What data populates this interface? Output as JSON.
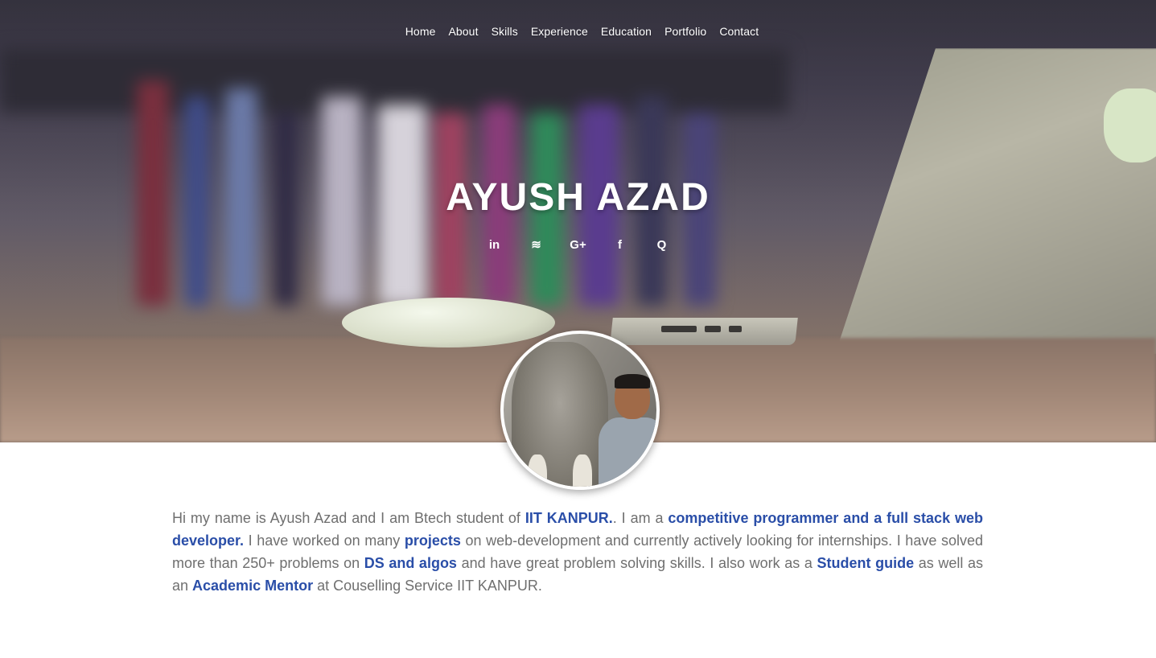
{
  "nav": {
    "items": [
      "Home",
      "About",
      "Skills",
      "Experience",
      "Education",
      "Portfolio",
      "Contact"
    ]
  },
  "hero": {
    "name": "AYUSH AZAD",
    "social": [
      {
        "icon": "linkedin-icon",
        "glyph": "in"
      },
      {
        "icon": "stack-overflow-icon",
        "glyph": "≋"
      },
      {
        "icon": "google-plus-icon",
        "glyph": "G+"
      },
      {
        "icon": "facebook-icon",
        "glyph": "f"
      },
      {
        "icon": "quora-icon",
        "glyph": "Q"
      }
    ]
  },
  "about": {
    "t1": "Hi my name is Ayush Azad and I am Btech student of ",
    "h1": "IIT KANPUR.",
    "t2": ". I am a ",
    "h2": "competitive programmer and a full stack web developer.",
    "t3": " I have worked on many ",
    "h3": "projects",
    "t4": " on web-development and currently actively looking for internships. I have solved more than 250+ problems on ",
    "h4": "DS and algos",
    "t5": " and have great problem solving skills. I also work as a ",
    "h5": "Student guide",
    "t6": " as well as an ",
    "h6": "Academic Mentor",
    "t7": " at Couselling Service IIT KANPUR."
  },
  "colors": {
    "highlight": "#2a4ea8",
    "body_text": "#6f6f6f"
  }
}
